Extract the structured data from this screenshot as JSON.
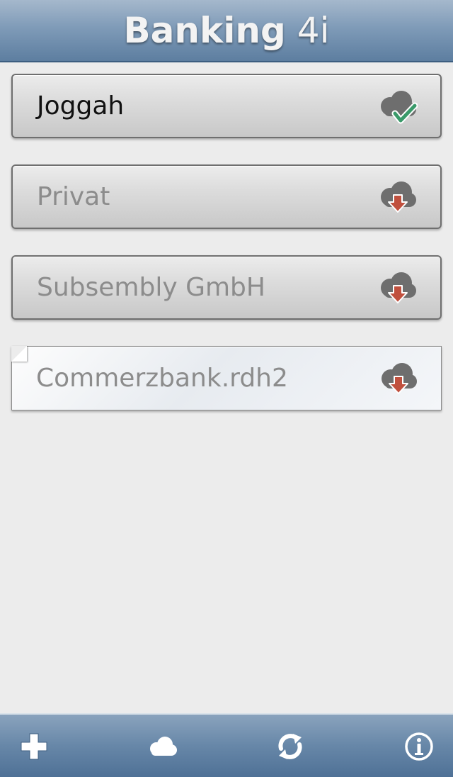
{
  "header": {
    "title_main": "Banking",
    "title_suffix": "4i"
  },
  "accounts": [
    {
      "label": "Joggah",
      "state": "active",
      "status_icon": "cloud-check-icon"
    },
    {
      "label": "Privat",
      "state": "inactive",
      "status_icon": "cloud-download-icon"
    },
    {
      "label": "Subsembly GmbH",
      "state": "inactive",
      "status_icon": "cloud-download-icon"
    },
    {
      "label": "Commerzbank.rdh2",
      "state": "inactive",
      "status_icon": "cloud-download-icon"
    }
  ],
  "toolbar": {
    "buttons": [
      "plus-icon",
      "cloud-icon",
      "sync-icon",
      "info-icon"
    ]
  },
  "colors": {
    "header_top": "#a5b8cc",
    "header_bottom": "#5d7ea0",
    "check_green": "#3a9a6a",
    "download_red": "#c0503e",
    "cloud_gray": "#6e6e6e"
  }
}
